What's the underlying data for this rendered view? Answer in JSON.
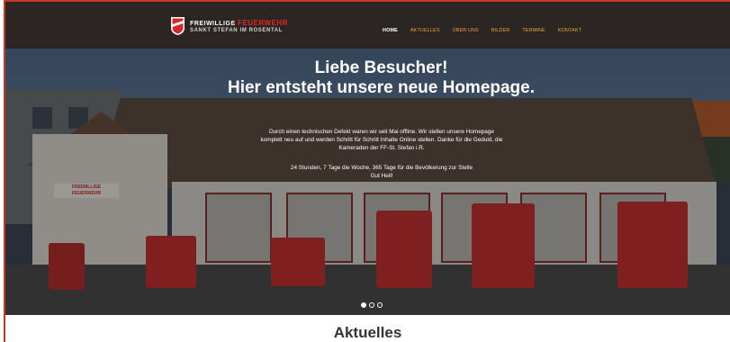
{
  "header": {
    "logo": {
      "line1_white": "FREIWILLIGE",
      "line1_red": "FEUERWEHR",
      "line2": "SANKT STEFAN IM ROSENTAL"
    },
    "nav": [
      {
        "label": "HOME",
        "active": true
      },
      {
        "label": "AKTUELLES",
        "active": false
      },
      {
        "label": "ÜBER UNS",
        "active": false
      },
      {
        "label": "BILDER",
        "active": false
      },
      {
        "label": "TERMINE",
        "active": false
      },
      {
        "label": "KONTAKT",
        "active": false
      }
    ]
  },
  "hero": {
    "title_line1": "Liebe Besucher!",
    "title_line2": "Hier entsteht unsere neue Homepage.",
    "text_line1": "Durch einen technischen Defekt waren wir seit Mai offline. Wir stellen unsere Homepage",
    "text_line2": "komplett neu auf und werden Schritt für Schritt Inhalte Online stellen. Danke für die Geduld, die",
    "text_line3": "Kameraden der FF-St. Stefan i.R.",
    "text2_line1": "24 Stunden, 7 Tage die Woche, 365 Tage für die Bevölkerung zur Stelle",
    "text2_line2": "Gut Heil!",
    "building_sign": "FREIWILLIGE FEUERWEHR",
    "slides": 3,
    "active_slide": 1
  },
  "section": {
    "title": "Aktuelles"
  },
  "colors": {
    "brand_red": "#c0392b",
    "nav_accent": "#e8a13a",
    "header_bg": "#2b2624"
  }
}
